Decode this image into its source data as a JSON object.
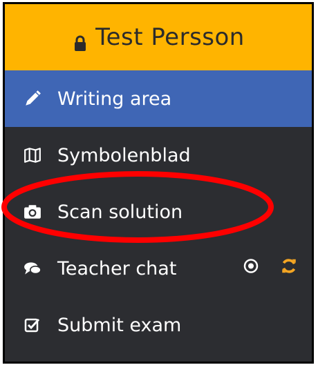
{
  "header": {
    "user_name": "Test Persson",
    "background_color": "#ffb400",
    "icon": "lock-icon"
  },
  "menu": {
    "items": [
      {
        "label": "Writing area",
        "icon": "pencil-icon",
        "active": true
      },
      {
        "label": "Symbolenblad",
        "icon": "map-icon",
        "active": false
      },
      {
        "label": "Scan solution",
        "icon": "camera-icon",
        "active": false,
        "highlighted": true
      },
      {
        "label": "Teacher chat",
        "icon": "chat-icon",
        "active": false,
        "extras": [
          "target-icon",
          "sync-icon"
        ]
      },
      {
        "label": "Submit exam",
        "icon": "checkbox-icon",
        "active": false
      }
    ],
    "active_color": "#3f66b5",
    "background_color": "#2c2d31",
    "sync_icon_color": "#f5a623",
    "highlight_color": "#ff0000"
  }
}
